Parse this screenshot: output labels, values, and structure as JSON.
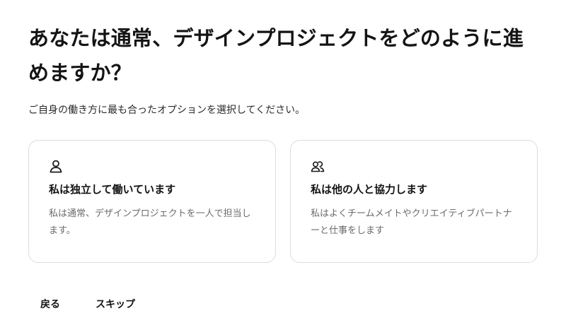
{
  "header": {
    "title": "あなたは通常、デザインプロジェクトをどのように進めますか？",
    "subtitle": "ご自身の働き方に最も合ったオプションを選択してください。"
  },
  "options": [
    {
      "icon": "person-icon",
      "title": "私は独立して働いています",
      "description": "私は通常、デザインプロジェクトを一人で担当します。"
    },
    {
      "icon": "people-icon",
      "title": "私は他の人と協力します",
      "description": "私はよくチームメイトやクリエイティブパートナーと仕事をします"
    }
  ],
  "footer": {
    "back_label": "戻る",
    "skip_label": "スキップ"
  }
}
